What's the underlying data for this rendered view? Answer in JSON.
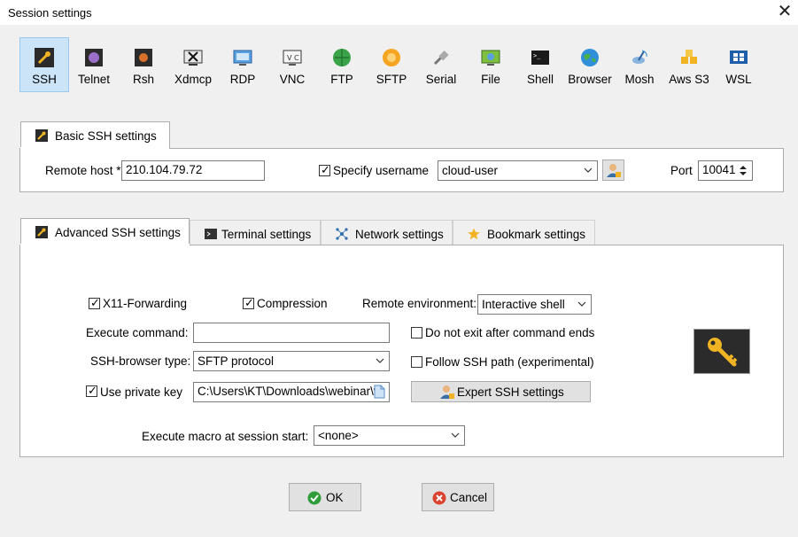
{
  "window": {
    "title": "Session settings",
    "close_symbol": "✕"
  },
  "session_types": [
    {
      "label": "SSH",
      "icon": "wrench-icon"
    },
    {
      "label": "Telnet",
      "icon": "telnet-icon"
    },
    {
      "label": "Rsh",
      "icon": "rsh-icon"
    },
    {
      "label": "Xdmcp",
      "icon": "xdmcp-icon"
    },
    {
      "label": "RDP",
      "icon": "rdp-monitor-icon"
    },
    {
      "label": "VNC",
      "icon": "vnc-icon"
    },
    {
      "label": "FTP",
      "icon": "ftp-globe-icon"
    },
    {
      "label": "SFTP",
      "icon": "sftp-icon"
    },
    {
      "label": "Serial",
      "icon": "serial-plug-icon"
    },
    {
      "label": "File",
      "icon": "file-monitor-icon"
    },
    {
      "label": "Shell",
      "icon": "shell-terminal-icon"
    },
    {
      "label": "Browser",
      "icon": "browser-globe-icon"
    },
    {
      "label": "Mosh",
      "icon": "mosh-satellite-icon"
    },
    {
      "label": "Aws S3",
      "icon": "aws-cubes-icon"
    },
    {
      "label": "WSL",
      "icon": "windows-icon"
    }
  ],
  "basic": {
    "tab_label": "Basic SSH settings",
    "remote_host_label": "Remote host *",
    "remote_host_value": "210.104.79.72",
    "specify_username_label": "Specify username",
    "specify_username_checked": true,
    "username_value": "cloud-user",
    "port_label": "Port",
    "port_value": "10041"
  },
  "adv_tabs": [
    {
      "label": "Advanced SSH settings",
      "icon": "wrench-icon",
      "active": true
    },
    {
      "label": "Terminal settings",
      "icon": "terminal-icon",
      "active": false
    },
    {
      "label": "Network settings",
      "icon": "network-icon",
      "active": false
    },
    {
      "label": "Bookmark settings",
      "icon": "star-icon",
      "active": false
    }
  ],
  "advanced": {
    "x11_label": "X11-Forwarding",
    "x11_checked": true,
    "compression_label": "Compression",
    "compression_checked": true,
    "remote_env_label": "Remote environment:",
    "remote_env_value": "Interactive shell",
    "execute_command_label": "Execute command:",
    "execute_command_value": "",
    "do_not_exit_label": "Do not exit after command ends",
    "do_not_exit_checked": false,
    "ssh_browser_label": "SSH-browser type:",
    "ssh_browser_value": "SFTP protocol",
    "follow_path_label": "Follow SSH path (experimental)",
    "follow_path_checked": false,
    "private_key_label": "Use private key",
    "private_key_checked": true,
    "private_key_value": "C:\\Users\\KT\\Downloads\\webinar\\w",
    "expert_button_label": "Expert SSH settings",
    "macro_label": "Execute macro at session start:",
    "macro_value": "<none>"
  },
  "buttons": {
    "ok": "OK",
    "cancel": "Cancel"
  },
  "colors": {
    "selected_bg": "#cce4f7",
    "ok_green": "#2e9d3a",
    "cancel_red": "#d9432f",
    "key_gold": "#f0b323"
  }
}
